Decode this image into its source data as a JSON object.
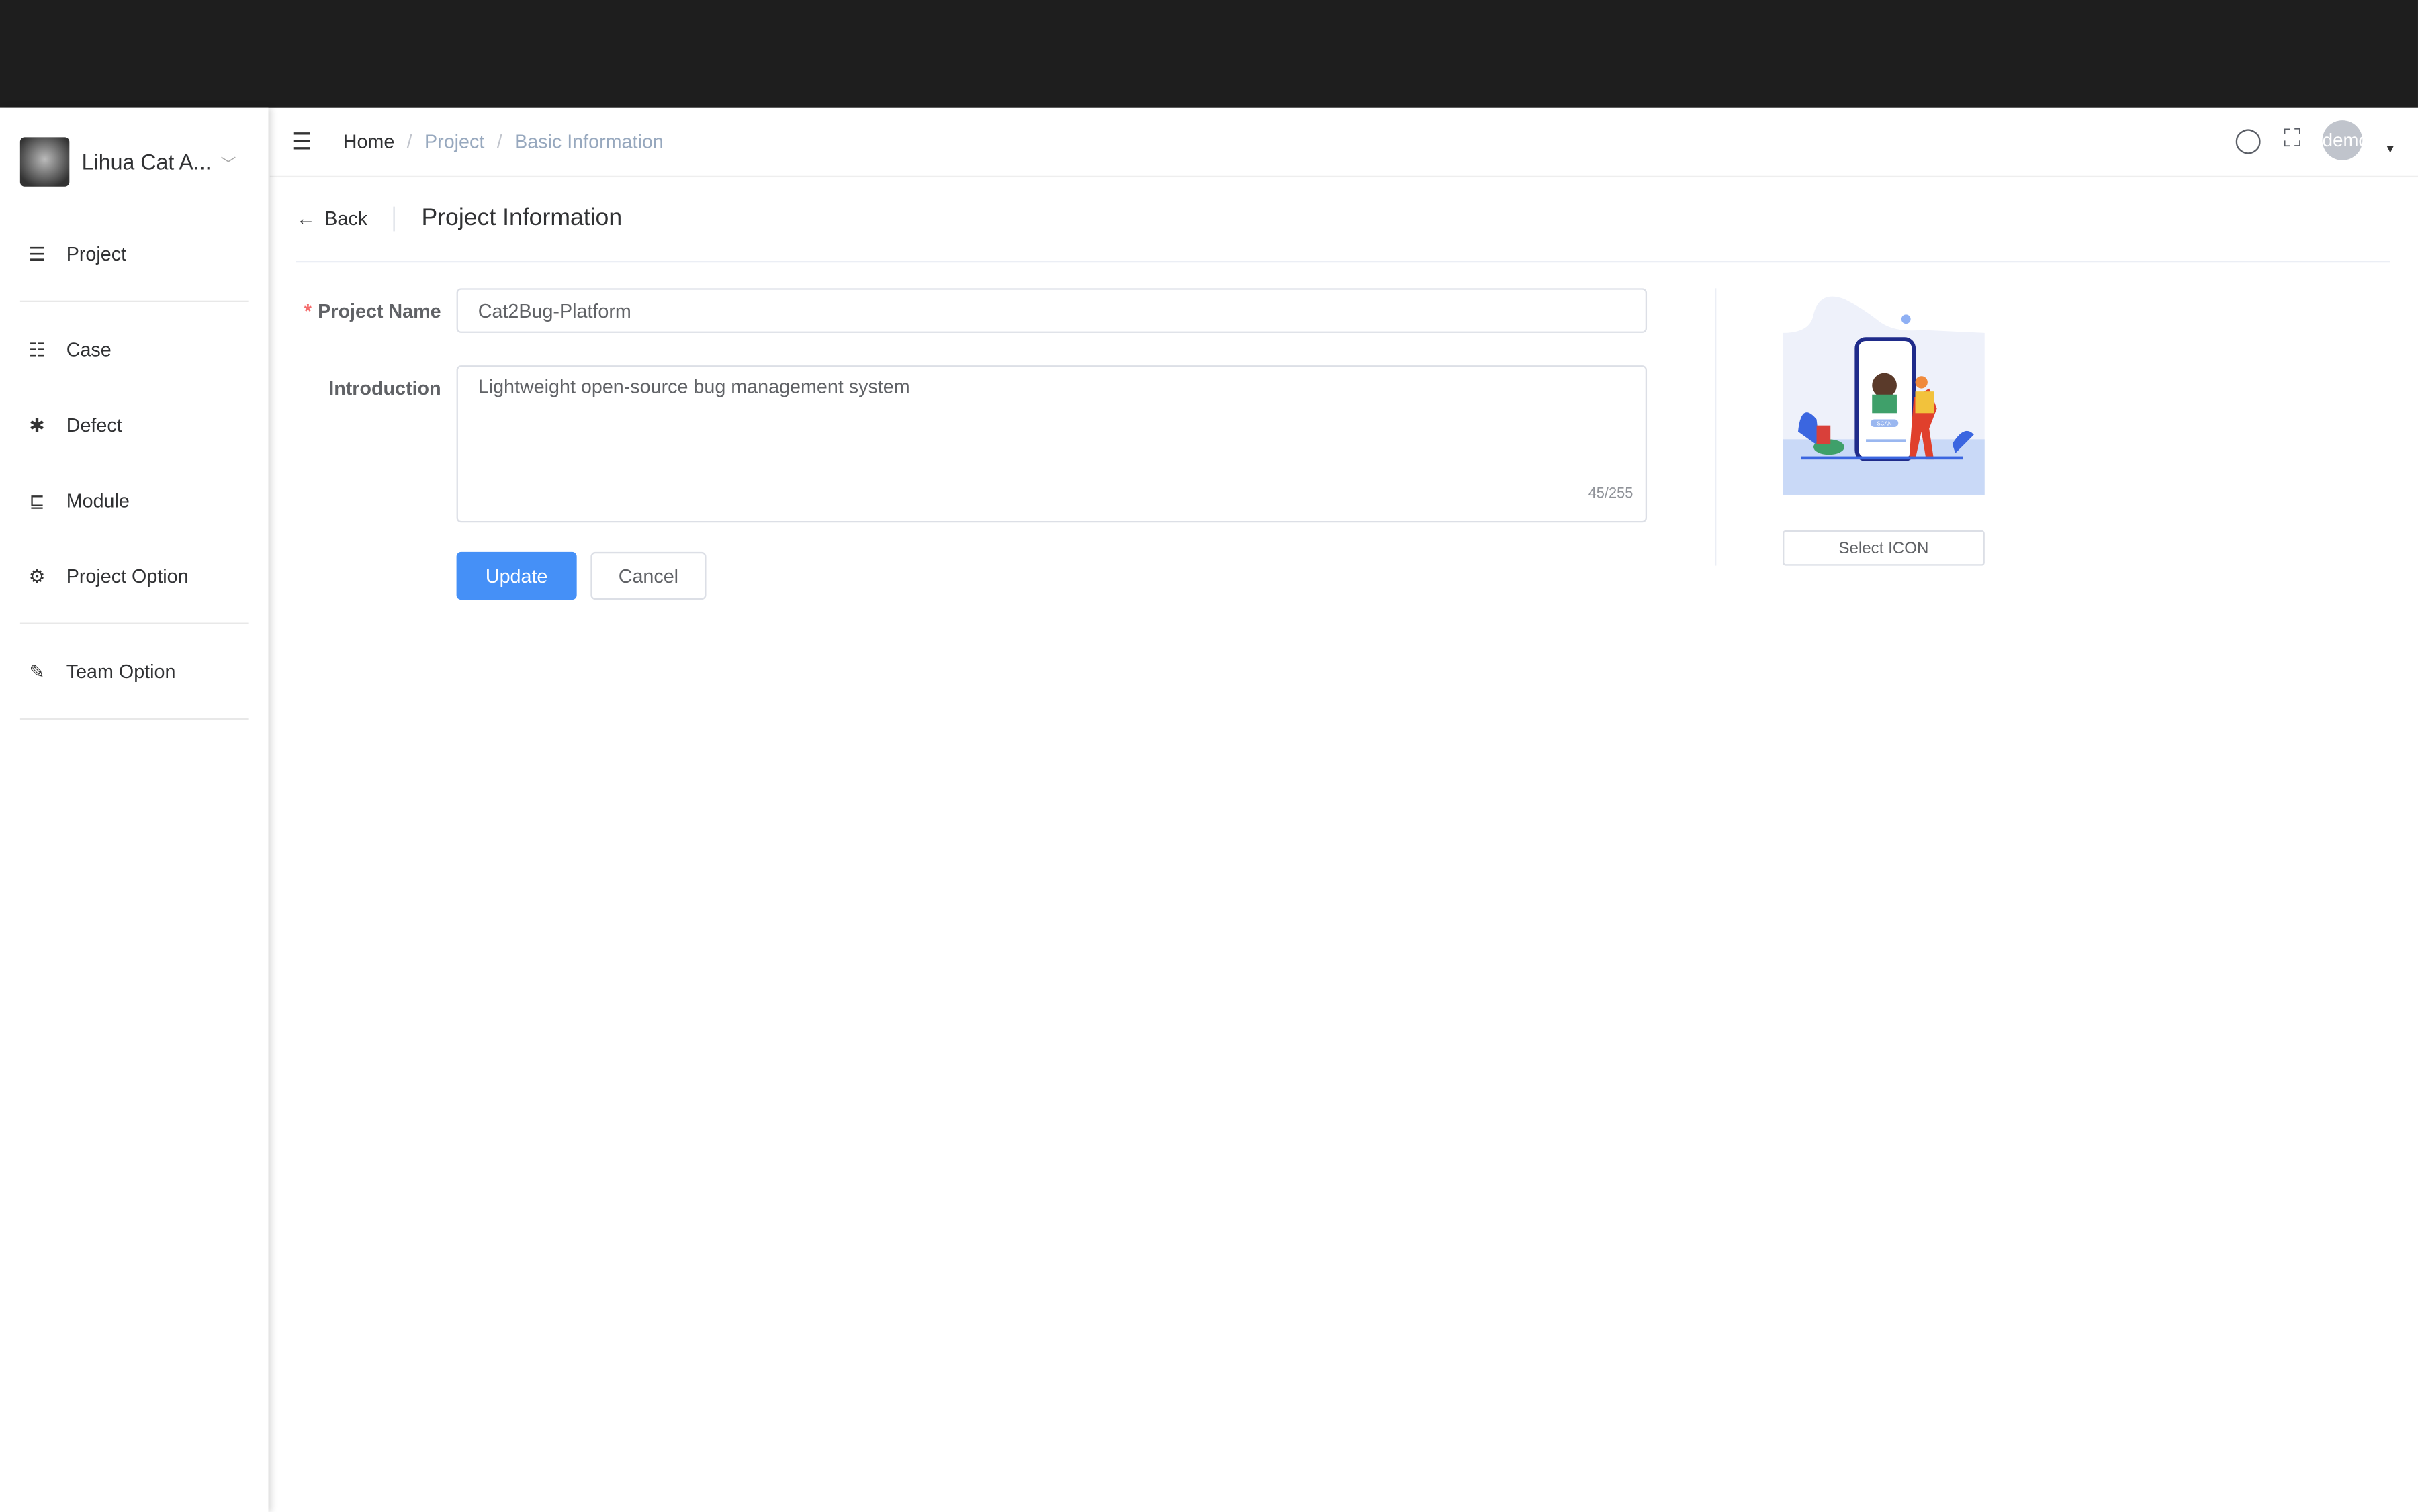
{
  "sidebar": {
    "team_name": "Lihua Cat A...",
    "items": [
      {
        "label": "Project",
        "icon": "list-icon"
      },
      {
        "label": "Case",
        "icon": "case-list-icon"
      },
      {
        "label": "Defect",
        "icon": "bug-icon"
      },
      {
        "label": "Module",
        "icon": "tree-icon"
      },
      {
        "label": "Project Option",
        "icon": "gear-icon"
      },
      {
        "label": "Team Option",
        "icon": "edit-document-icon"
      }
    ]
  },
  "header": {
    "breadcrumb": [
      "Home",
      "Project",
      "Basic Information"
    ],
    "user": "demo"
  },
  "page": {
    "back_label": "Back",
    "title": "Project Information"
  },
  "form": {
    "name_label": "Project Name",
    "name_value": "Cat2Bug-Platform",
    "intro_label": "Introduction",
    "intro_value": "Lightweight open-source bug management system",
    "intro_count": "45/255",
    "update_label": "Update",
    "cancel_label": "Cancel",
    "select_icon_label": "Select ICON",
    "illustration_text": "SCAN"
  },
  "colors": {
    "primary": "#4590f7",
    "topbar": "#1e1e1e",
    "required": "#f56c6c"
  }
}
